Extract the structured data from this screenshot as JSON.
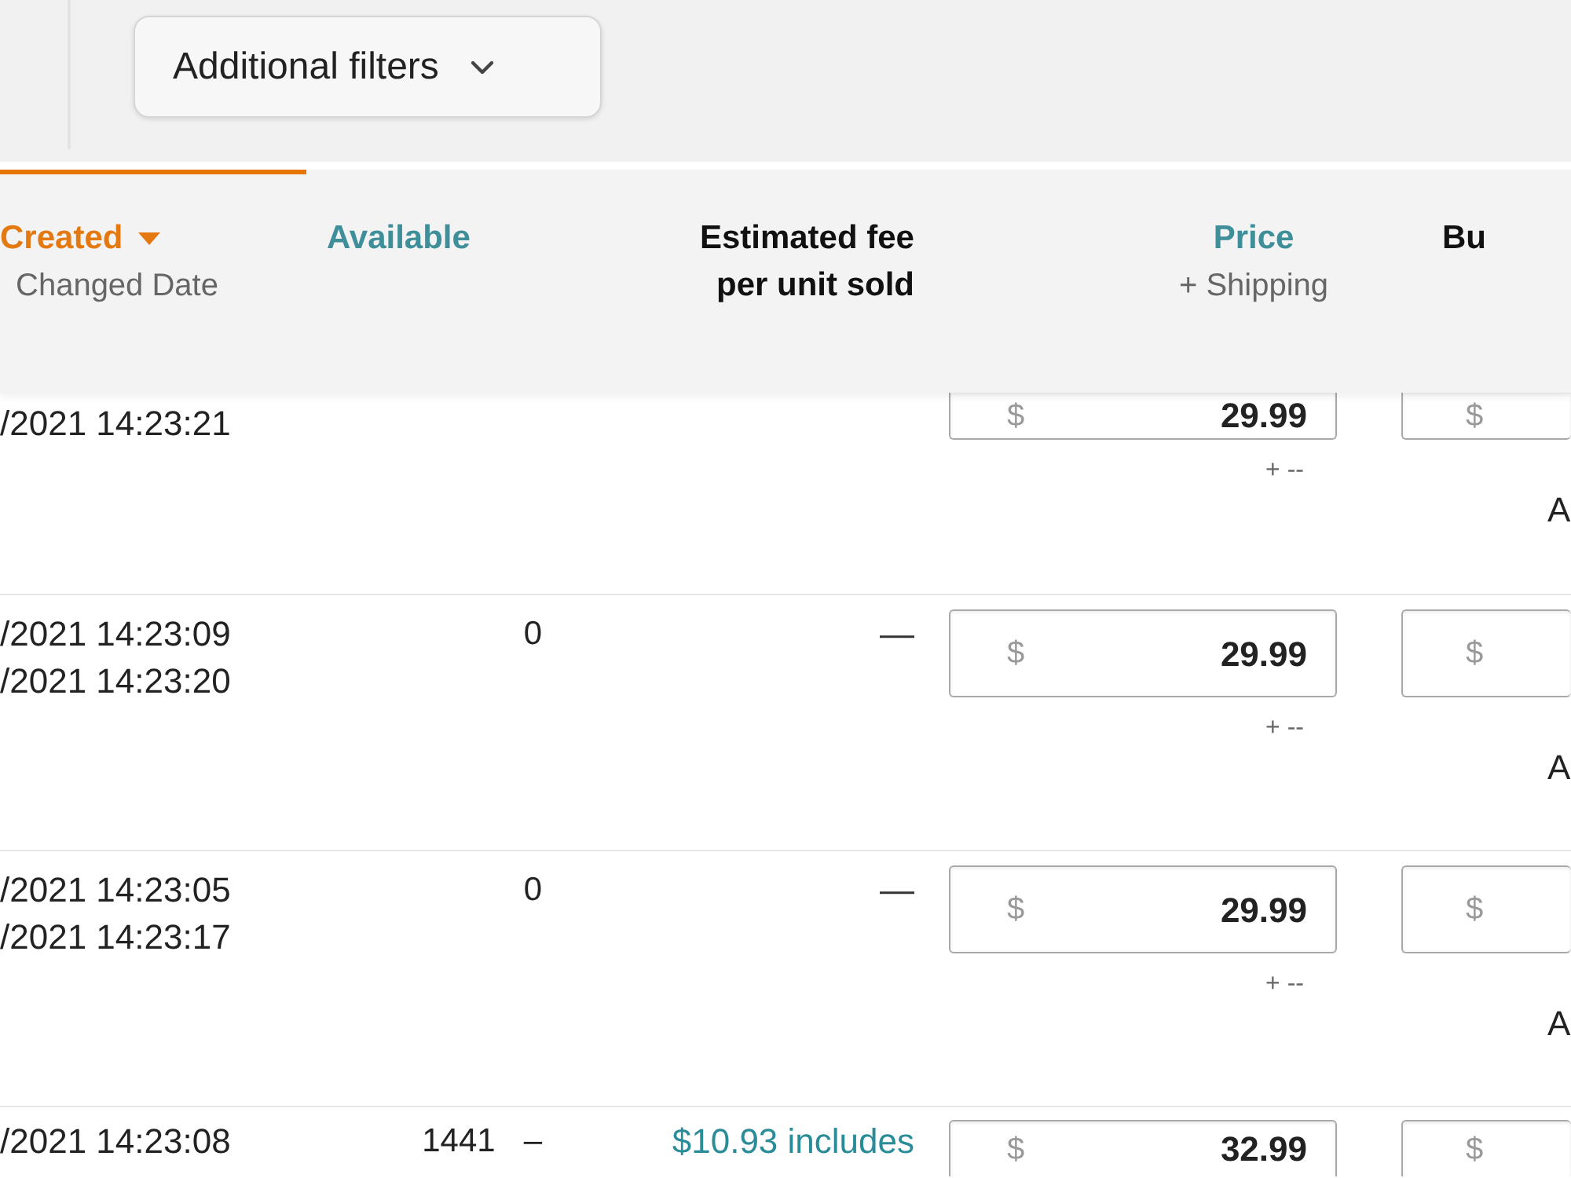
{
  "filter_bar": {
    "additional_filters": {
      "label": "Additional filters"
    }
  },
  "table": {
    "columns": [
      {
        "label": "Created",
        "sublabel": "Changed Date",
        "kind": "link",
        "sorted": true
      },
      {
        "label": "Available",
        "kind": "link",
        "sorted": false
      },
      {
        "label": "Estimated fee\nper unit sold",
        "kind": "plain",
        "sorted": false
      },
      {
        "label": "Price",
        "sublabel": "+ Shipping",
        "kind": "link",
        "sorted": false
      },
      {
        "label": "Bu",
        "kind": "plain",
        "sorted": false
      }
    ],
    "rows": [
      {
        "clipped_top": true,
        "clipped_bottom": false,
        "dates": [
          "/2021 14:23:21"
        ],
        "price": {
          "currency": "$",
          "value": "29.99",
          "shipping": "+ --"
        },
        "business_price": {
          "currency": "$"
        },
        "column_5_text": "A"
      },
      {
        "clipped_top": false,
        "clipped_bottom": false,
        "dates": [
          "/2021 14:23:09",
          "/2021 14:23:20"
        ],
        "available": [
          "0"
        ],
        "fee": {
          "text": "—",
          "kind": "plain"
        },
        "price": {
          "currency": "$",
          "value": "29.99",
          "shipping": "+ --"
        },
        "business_price": {
          "currency": "$"
        },
        "column_5_text": "A"
      },
      {
        "clipped_top": false,
        "clipped_bottom": false,
        "dates": [
          "/2021 14:23:05",
          "/2021 14:23:17"
        ],
        "available": [
          "0"
        ],
        "fee": {
          "text": "—",
          "kind": "plain"
        },
        "price": {
          "currency": "$",
          "value": "29.99",
          "shipping": "+ --"
        },
        "business_price": {
          "currency": "$"
        },
        "column_5_text": "A"
      },
      {
        "clipped_top": false,
        "clipped_bottom": true,
        "dates": [
          "/2021 14:23:08"
        ],
        "available": [
          "1441",
          "–"
        ],
        "fee": {
          "text": "$10.93 includes",
          "kind": "link"
        },
        "price": {
          "currency": "$",
          "value": "32.99"
        },
        "business_price": {
          "currency": "$"
        }
      }
    ]
  }
}
